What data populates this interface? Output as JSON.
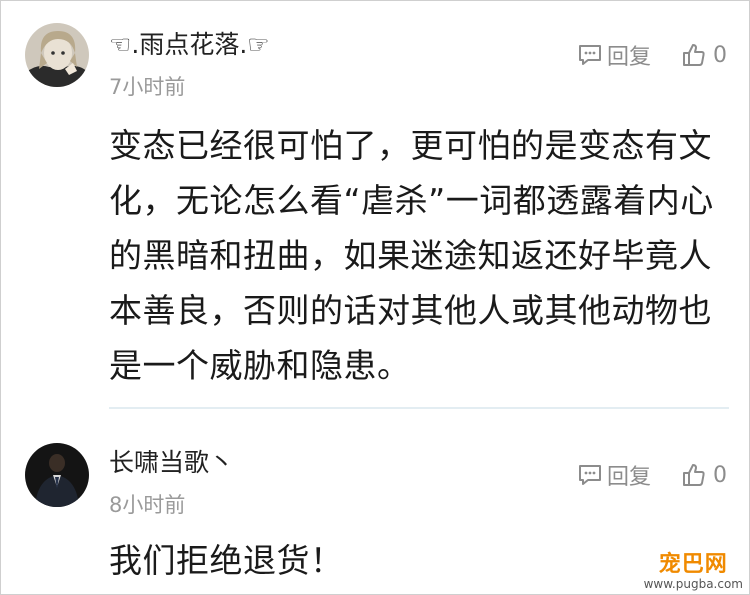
{
  "comments": [
    {
      "username": "☜.雨点花落.☞",
      "time": "7小时前",
      "reply_label": "回复",
      "like_count": "0",
      "text": "变态已经很可怕了，更可怕的是变态有文化，无论怎么看“虐杀”一词都透露着内心的黑暗和扭曲，如果迷途知返还好毕竟人本善良，否则的话对其他人或其他动物也是一个威胁和隐患。"
    },
    {
      "username": "长啸当歌丶",
      "time": "8小时前",
      "reply_label": "回复",
      "like_count": "0",
      "text": "我们拒绝退货！"
    }
  ],
  "watermark": {
    "name": "宠巴网",
    "url": "www.pugba.com"
  },
  "icons": {
    "reply": "comment-bubble-icon",
    "like": "thumbs-up-icon"
  },
  "colors": {
    "text": "#1a1a1a",
    "meta": "#9a9a9a",
    "action": "#8c8c8c",
    "divider": "#e3edf2",
    "watermark": "#f08a00"
  }
}
